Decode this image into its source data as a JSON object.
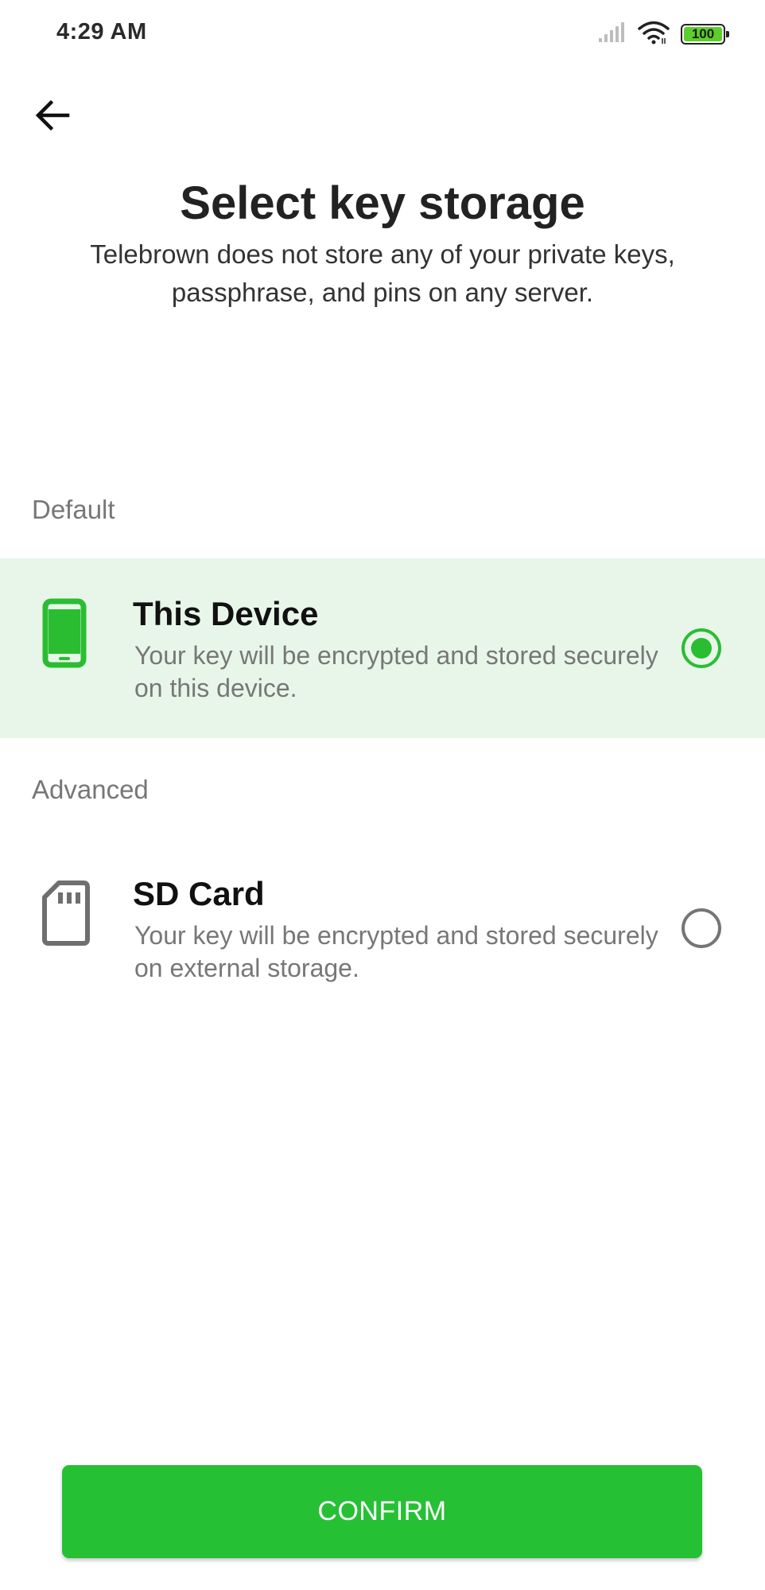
{
  "status_bar": {
    "time": "4:29 AM",
    "battery_level": "100",
    "icons": [
      "signal-icon",
      "wifi-icon",
      "battery-icon"
    ]
  },
  "header": {
    "back_icon": "arrow-left-icon",
    "title": "Select key storage",
    "subtitle": "Telebrown does not store any of your private keys, passphrase, and pins on any server."
  },
  "sections": {
    "default_label": "Default",
    "advanced_label": "Advanced"
  },
  "options": [
    {
      "icon": "smartphone-icon",
      "title": "This Device",
      "description": "Your key will be encrypted and stored securely on this device.",
      "selected": true
    },
    {
      "icon": "sd-card-icon",
      "title": "SD Card",
      "description": "Your key will be encrypted and stored securely on external storage.",
      "selected": false
    }
  ],
  "confirm": {
    "label": "CONFIRM"
  },
  "colors": {
    "accent": "#26c034",
    "selected_bg": "#e8f6e9",
    "secondary_text": "#777777"
  }
}
